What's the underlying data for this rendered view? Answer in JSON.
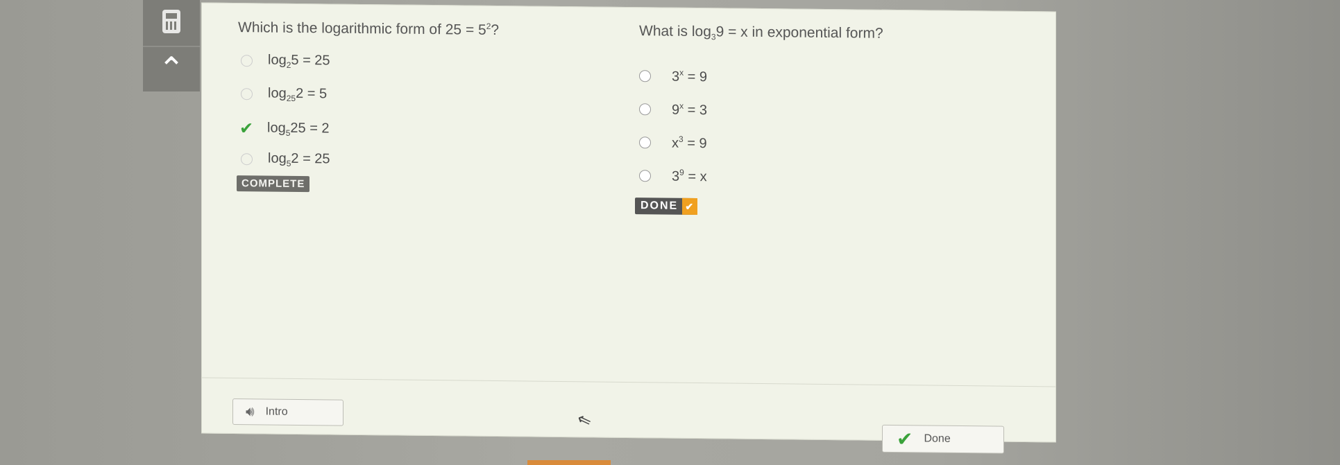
{
  "toolbar": {
    "calculator_icon": "calculator-icon",
    "collapse_icon": "up-arrow-icon",
    "collapse_glyph": "⌃"
  },
  "question1": {
    "prompt_prefix": "Which is the logarithmic form of 25 = 5",
    "prompt_sup": "2",
    "prompt_suffix": "?",
    "options": [
      {
        "pre": "log",
        "sub": "2",
        "post": "5 = 25",
        "state": "unselected"
      },
      {
        "pre": "log",
        "sub": "25",
        "post": "2 = 5",
        "state": "unselected"
      },
      {
        "pre": "log",
        "sub": "5",
        "post": "25 = 2",
        "state": "correct"
      },
      {
        "pre": "log",
        "sub": "5",
        "post": "2 = 25",
        "state": "unselected"
      }
    ],
    "status": "COMPLETE"
  },
  "question2": {
    "prompt_prefix": "What is log",
    "prompt_sub": "3",
    "prompt_suffix": "9 = x in exponential form?",
    "options": [
      {
        "base": "3",
        "sup": "x",
        "post": " = 9"
      },
      {
        "base": "9",
        "sup": "x",
        "post": " = 3"
      },
      {
        "base": "x",
        "sup": "3",
        "post": " = 9"
      },
      {
        "base": "3",
        "sup": "9",
        "post": " = x"
      }
    ],
    "status": "DONE",
    "status_tick": "✔"
  },
  "footer": {
    "intro_label": "Intro",
    "done_label": "Done",
    "intro_glyph": "🔊︎",
    "done_glyph": "✔",
    "cursor_glyph": "⇖"
  },
  "colors": {
    "check": "#3aa23a",
    "done_badge_tick": "#f0a020",
    "panel_bg": "#f1f3e8"
  }
}
